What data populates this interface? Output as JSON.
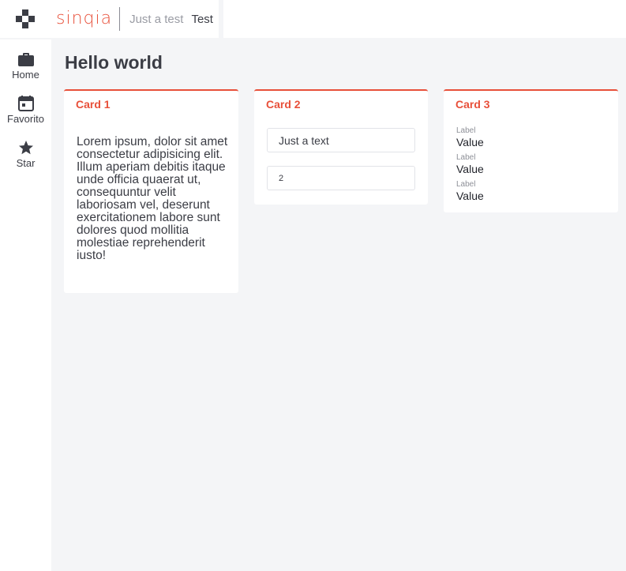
{
  "header": {
    "brand": "sinqia",
    "breadcrumb": [
      "Just a test",
      "Test"
    ]
  },
  "sidebar": {
    "items": [
      {
        "label": "Home",
        "icon": "briefcase-icon"
      },
      {
        "label": "Favorito",
        "icon": "calendar-icon"
      },
      {
        "label": "Star",
        "icon": "star-icon"
      }
    ]
  },
  "main": {
    "title": "Hello world",
    "cards": [
      {
        "title": "Card 1",
        "text": "Lorem ipsum, dolor sit amet consectetur adipisicing elit. Illum aperiam debitis itaque unde officia quaerat ut, consequuntur velit laboriosam vel, deserunt exercitationem labore sunt dolores quod mollitia molestiae reprehenderit iusto!"
      },
      {
        "title": "Card 2",
        "text_field_value": "Just a text",
        "number_field_value": "2"
      },
      {
        "title": "Card 3",
        "fields": [
          {
            "label": "Label",
            "value": "Value"
          },
          {
            "label": "Label",
            "value": "Value"
          },
          {
            "label": "Label",
            "value": "Value"
          }
        ]
      }
    ]
  },
  "colors": {
    "accent": "#e8503a",
    "text": "#3b3d45",
    "background": "#f4f5f7"
  }
}
